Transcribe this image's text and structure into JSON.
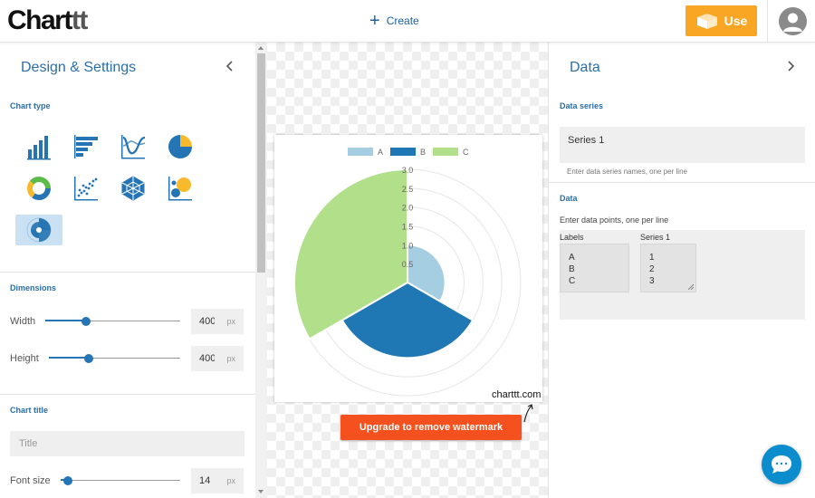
{
  "topbar": {
    "logo_main": "Chart",
    "logo_suffix": "tt",
    "create_label": "Create",
    "use_label": "Use"
  },
  "left_panel": {
    "title": "Design & Settings",
    "chart_type_label": "Chart type",
    "chart_types": [
      {
        "icon": "bar-chart-icon",
        "selected": false
      },
      {
        "icon": "horizontal-bar-chart-icon",
        "selected": false
      },
      {
        "icon": "line-chart-icon",
        "selected": false
      },
      {
        "icon": "pie-chart-icon",
        "selected": false
      },
      {
        "icon": "doughnut-chart-icon",
        "selected": false
      },
      {
        "icon": "scatter-chart-icon",
        "selected": false
      },
      {
        "icon": "radar-chart-icon",
        "selected": false
      },
      {
        "icon": "bubble-chart-icon",
        "selected": false
      },
      {
        "icon": "polar-area-chart-icon",
        "selected": true
      }
    ],
    "dimensions_label": "Dimensions",
    "width_label": "Width",
    "width_value": "400",
    "width_unit": "px",
    "width_slider_fraction": 0.3,
    "height_label": "Height",
    "height_value": "400",
    "height_unit": "px",
    "height_slider_fraction": 0.3,
    "chart_title_label": "Chart title",
    "title_placeholder": "Title",
    "font_size_label": "Font size",
    "font_size_value": "14",
    "font_size_unit": "px",
    "font_size_slider_fraction": 0.06
  },
  "canvas": {
    "watermark": "charttt.com",
    "upgrade_label": "Upgrade to remove watermark"
  },
  "right_panel": {
    "title": "Data",
    "data_series_label": "Data series",
    "series_value": "Series 1",
    "series_hint": "Enter data series names, one per line",
    "data_label": "Data",
    "data_hint": "Enter data points, one per line",
    "labels_header": "Labels",
    "series_header": "Series 1",
    "labels": [
      "A",
      "B",
      "C"
    ],
    "values": [
      "1",
      "2",
      "3"
    ]
  },
  "colors": {
    "accent": "#2b6ea8",
    "use_button": "#f8a623",
    "upgrade_button": "#f4511e",
    "chat": "#0a8ccd"
  },
  "chart_data": {
    "type": "polarArea",
    "categories": [
      "A",
      "B",
      "C"
    ],
    "series": [
      {
        "name": "Series 1",
        "values": [
          1,
          2,
          3
        ]
      }
    ],
    "colors": [
      "#a6cee3",
      "#1f78b4",
      "#b2df8a"
    ],
    "legend": "top",
    "r_ticks": [
      "0.5",
      "1.0",
      "1.5",
      "2.0",
      "2.5",
      "3.0"
    ],
    "rlim": [
      0,
      3
    ]
  }
}
